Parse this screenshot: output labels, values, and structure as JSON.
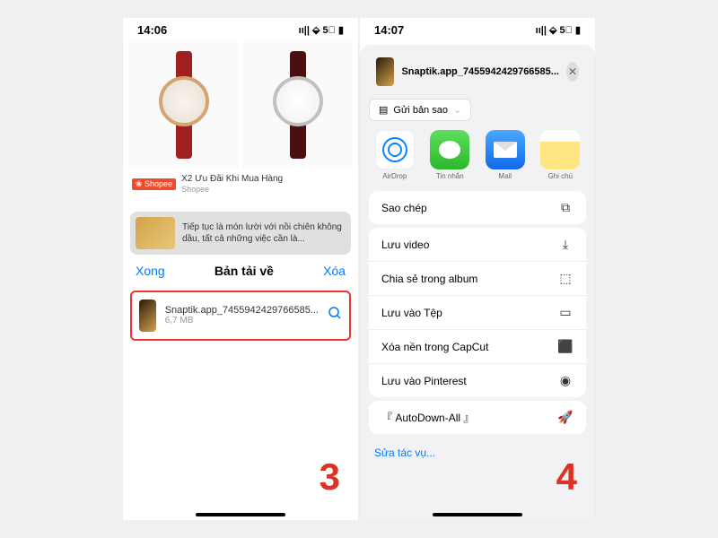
{
  "left": {
    "time": "14:06",
    "signal": "ıı|| ⬙ 5⃞ ▮",
    "product": {
      "title": "X2 Ưu Đãi Khi Mua Hàng",
      "sub": "Shopee",
      "badge": "❀ Shopee"
    },
    "news": "Tiếp tục là món lười với nồi chiên không dầu, tất cả những việc cần là...",
    "downloads": {
      "done": "Xong",
      "title": "Bản tải về",
      "delete": "Xóa"
    },
    "file": {
      "name": "Snaptik.app_7455942429766585...",
      "size": "6,7 MB"
    },
    "step": "3"
  },
  "right": {
    "time": "14:07",
    "signal": "ıı|| ⬙ 5⃞ ▮",
    "shareTitle": "Snaptik.app_7455942429766585...",
    "sendCopy": "Gửi bản sao",
    "apps": {
      "airdrop": "AirDrop",
      "messages": "Tin nhắn",
      "mail": "Mail",
      "notes": "Ghi chú"
    },
    "actions": {
      "copy": "Sao chép",
      "saveVideo": "Lưu video",
      "shareAlbum": "Chia sẻ trong album",
      "saveFiles": "Lưu vào Tệp",
      "capcut": "Xóa nền trong CapCut",
      "pinterest": "Lưu vào Pinterest",
      "autodown": "『 AutoDown-All 』"
    },
    "edit": "Sửa tác vụ...",
    "step": "4"
  }
}
